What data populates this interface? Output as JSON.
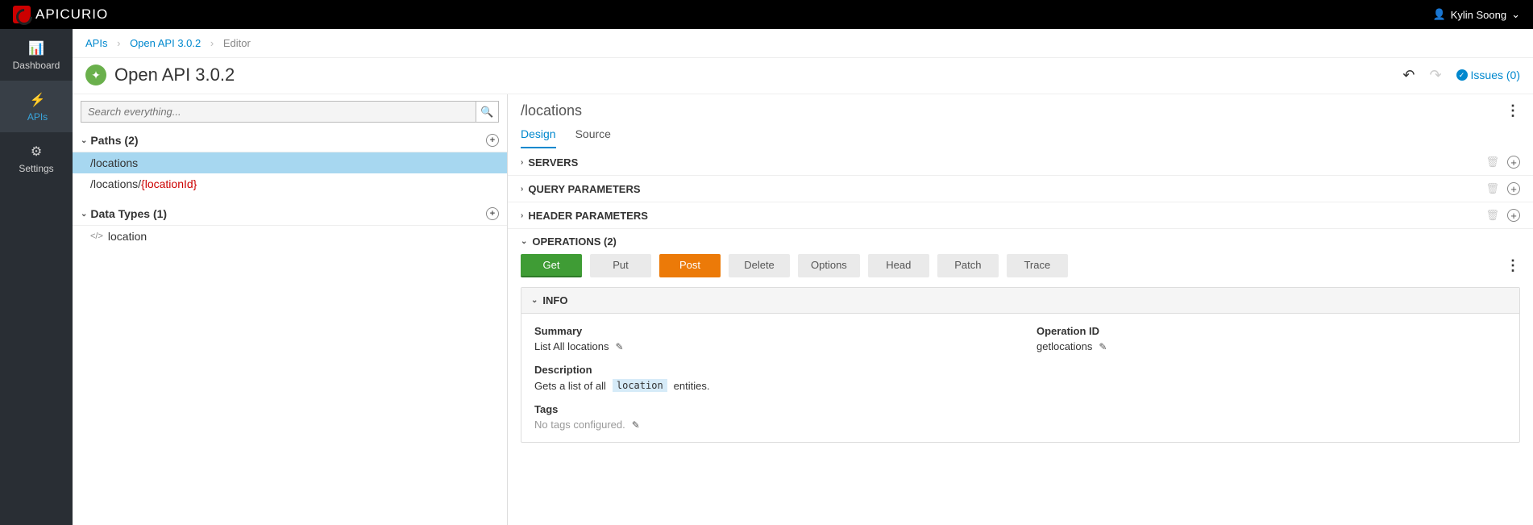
{
  "brand": {
    "name": "APICURIO"
  },
  "user": {
    "name": "Kylin Soong"
  },
  "sidenav": {
    "dashboard": "Dashboard",
    "apis": "APIs",
    "settings": "Settings"
  },
  "breadcrumb": {
    "apis": "APIs",
    "api_name": "Open API 3.0.2",
    "editor": "Editor"
  },
  "page": {
    "title": "Open API 3.0.2",
    "issues_label": "Issues (0)"
  },
  "search": {
    "placeholder": "Search everything..."
  },
  "left": {
    "paths_header": "Paths (2)",
    "paths": [
      {
        "text": "/locations",
        "prefix": "",
        "param": "",
        "suffix": ""
      },
      {
        "text": "/locations/{locationId}",
        "prefix": "/locations/",
        "param": "{locationId}",
        "suffix": ""
      }
    ],
    "datatypes_header": "Data Types (1)",
    "datatypes": [
      {
        "name": "location"
      }
    ]
  },
  "right": {
    "path_title": "/locations",
    "tabs": {
      "design": "Design",
      "source": "Source"
    },
    "sections": {
      "servers": "SERVERS",
      "query": "QUERY PARAMETERS",
      "header": "HEADER PARAMETERS",
      "operations": "OPERATIONS (2)"
    },
    "ops": {
      "get": "Get",
      "put": "Put",
      "post": "Post",
      "delete": "Delete",
      "options": "Options",
      "head": "Head",
      "patch": "Patch",
      "trace": "Trace"
    },
    "info": {
      "header": "INFO",
      "summary_label": "Summary",
      "summary_value": "List All locations",
      "opid_label": "Operation ID",
      "opid_value": "getlocations",
      "desc_label": "Description",
      "desc_prefix": "Gets a list of all ",
      "desc_chip": "location",
      "desc_suffix": " entities.",
      "tags_label": "Tags",
      "tags_value": "No tags configured."
    }
  }
}
